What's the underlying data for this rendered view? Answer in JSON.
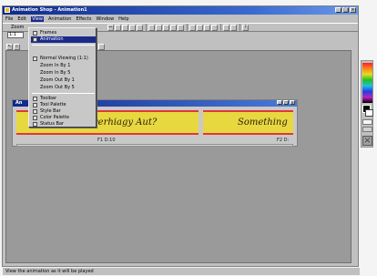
{
  "window": {
    "title": "Animation Shop - Animation1"
  },
  "menu": [
    "File",
    "Edit",
    "View",
    "Animation",
    "Effects",
    "Window",
    "Help"
  ],
  "toolbar": {
    "zoom_label": "Zoom",
    "zoom_value": "1:1"
  },
  "view_menu": {
    "items": [
      "Frames",
      "Animation",
      "Normal Viewing (1:1)",
      "Zoom In By 1",
      "Zoom In By 5",
      "Zoom Out By 1",
      "Zoom Out By 5",
      "Toolbar",
      "Tool Palette",
      "Style Bar",
      "Color Palette",
      "Status Bar"
    ]
  },
  "animation_window": {
    "title": "An",
    "frames": [
      {
        "text": "yerhiagy Aut?",
        "label": "F1  D:10"
      },
      {
        "text": "Something",
        "label": "F2  D:"
      }
    ]
  },
  "status": {
    "text": "View the animation as it will be played"
  },
  "colors": {
    "title_bar": "#102a8c",
    "frame_bg": "#e8d840",
    "frame_border": "#e03838",
    "workspace": "#9a9a9a"
  }
}
